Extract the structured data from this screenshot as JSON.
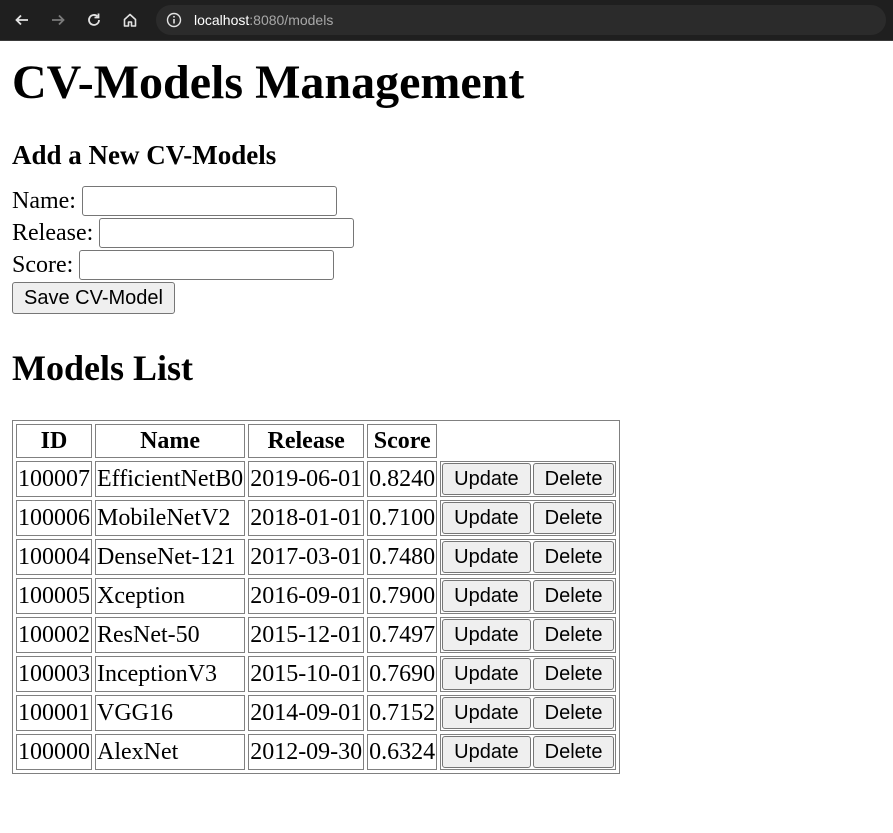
{
  "browser": {
    "url_host": "localhost",
    "url_rest": ":8080/models"
  },
  "page": {
    "title": "CV-Models Management",
    "form_heading": "Add a New CV-Models",
    "fields": {
      "name_label": "Name:",
      "release_label": "Release:",
      "score_label": "Score:",
      "name_value": "",
      "release_value": "",
      "score_value": ""
    },
    "save_label": "Save CV-Model",
    "list_heading": "Models List"
  },
  "table": {
    "headers": [
      "ID",
      "Name",
      "Release",
      "Score"
    ],
    "update_label": "Update",
    "delete_label": "Delete",
    "rows": [
      {
        "id": "100007",
        "name": "EfficientNetB0",
        "release": "2019-06-01",
        "score": "0.8240"
      },
      {
        "id": "100006",
        "name": "MobileNetV2",
        "release": "2018-01-01",
        "score": "0.7100"
      },
      {
        "id": "100004",
        "name": "DenseNet-121",
        "release": "2017-03-01",
        "score": "0.7480"
      },
      {
        "id": "100005",
        "name": "Xception",
        "release": "2016-09-01",
        "score": "0.7900"
      },
      {
        "id": "100002",
        "name": "ResNet-50",
        "release": "2015-12-01",
        "score": "0.7497"
      },
      {
        "id": "100003",
        "name": "InceptionV3",
        "release": "2015-10-01",
        "score": "0.7690"
      },
      {
        "id": "100001",
        "name": "VGG16",
        "release": "2014-09-01",
        "score": "0.7152"
      },
      {
        "id": "100000",
        "name": "AlexNet",
        "release": "2012-09-30",
        "score": "0.6324"
      }
    ]
  },
  "colors": {
    "chrome_bg": "#1f1f1f",
    "addressbar_bg": "#2b2b2b",
    "button_bg": "#efefef"
  }
}
